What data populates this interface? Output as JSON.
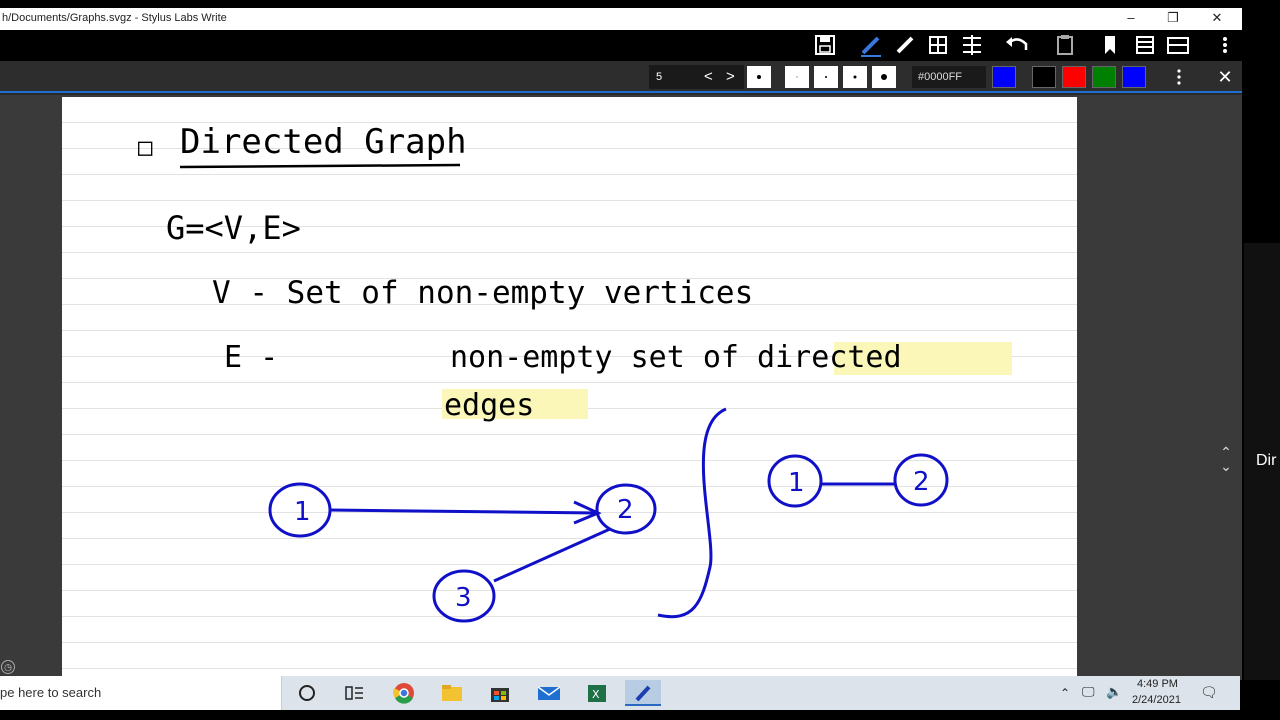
{
  "window": {
    "title": "h/Documents/Graphs.svgz - Stylus Labs Write",
    "controls": {
      "minimize": "–",
      "restore": "❐",
      "close": "✕"
    }
  },
  "toolbar_top": {
    "icons": [
      "save-icon",
      "pen-icon",
      "eraser-icon",
      "grid-select-icon",
      "insert-space-icon",
      "undo-icon",
      "clipboard-icon",
      "bookmark-icon",
      "page-setup-icon",
      "view-icon",
      "more-icon"
    ]
  },
  "toolbar_pen": {
    "page_number": "5",
    "prev": "<",
    "next": ">",
    "color_hex": "#0000FF",
    "swatches": [
      "#0000FF",
      "#000000",
      "#FF0000",
      "#008000",
      "#0000FF"
    ],
    "close": "✕"
  },
  "note": {
    "bullet": "□",
    "heading": "Directed Graph",
    "def": "G=<V,E>",
    "line_v": "V - Set of non-empty vertices",
    "line_e_label": "E -",
    "line_e_text": "non-empty set of directed",
    "line_e_text2": "edges",
    "highlight_color": "#fbf7b8",
    "ink_color": "#1010c8",
    "graph_left_nodes": [
      "1",
      "2",
      "3"
    ],
    "graph_right_nodes": [
      "1",
      "2"
    ]
  },
  "side": {
    "label": "Dir"
  },
  "taskbar": {
    "search_text": "pe here to search",
    "time": "4:49 PM",
    "date": "2/24/2021"
  }
}
